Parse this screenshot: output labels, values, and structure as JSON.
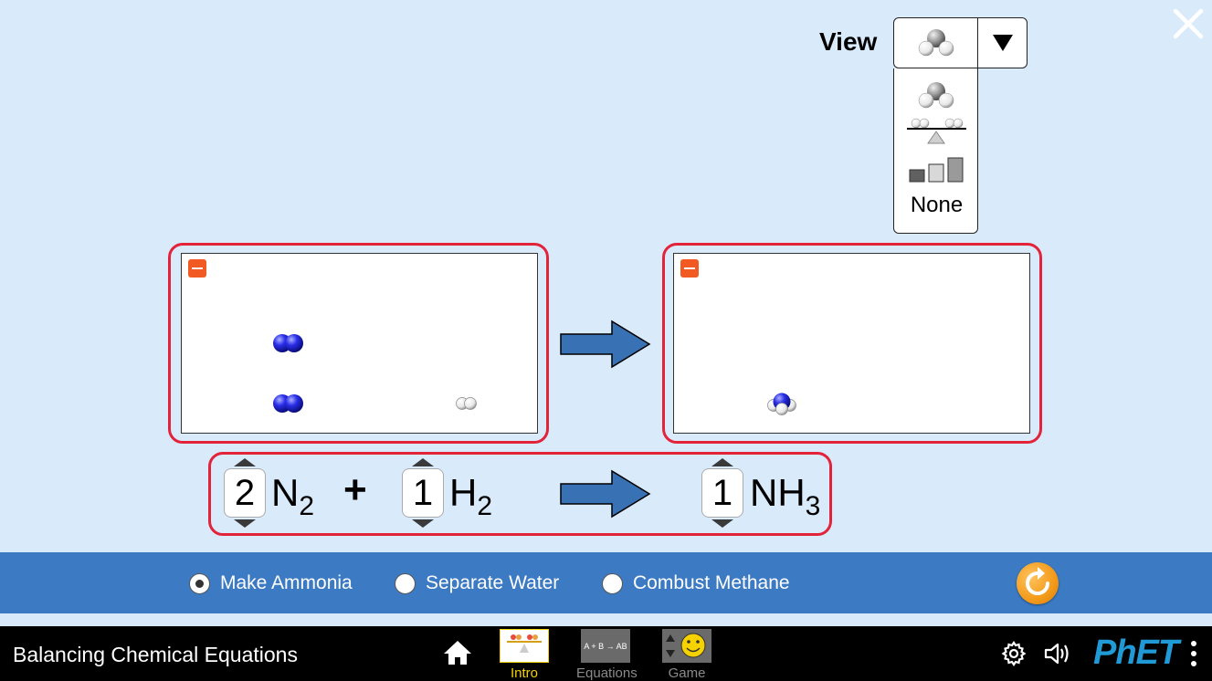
{
  "view": {
    "label": "View",
    "options": [
      "molecules-icon",
      "balance-scale-icon",
      "bar-charts-icon"
    ],
    "none_label": "None"
  },
  "equation": {
    "reactants": [
      {
        "coefficient": "2",
        "symbol": "N",
        "subscript": "2"
      },
      {
        "coefficient": "1",
        "symbol": "H",
        "subscript": "2"
      }
    ],
    "plus": "+",
    "products": [
      {
        "coefficient": "1",
        "symbol": "NH",
        "subscript": "3"
      }
    ]
  },
  "reactions": {
    "options": [
      {
        "label": "Make Ammonia",
        "selected": true
      },
      {
        "label": "Separate Water",
        "selected": false
      },
      {
        "label": "Combust Methane",
        "selected": false
      }
    ]
  },
  "navbar": {
    "title": "Balancing Chemical Equations",
    "screens": [
      {
        "label": "Intro",
        "active": true
      },
      {
        "label": "Equations",
        "active": false
      },
      {
        "label": "Game",
        "active": false
      }
    ],
    "equations_thumb_text": "A + B → AB",
    "logo": "PhET"
  },
  "colors": {
    "background": "#d9eafb",
    "outline_red": "#e2233a",
    "collapse_orange": "#f15a22",
    "control_blue": "#3c7ac3",
    "nitrogen_blue": "#2a2ee8",
    "hydrogen_white": "#ffffff",
    "arrow_blue": "#3872b4",
    "active_yellow": "#f5d200"
  }
}
